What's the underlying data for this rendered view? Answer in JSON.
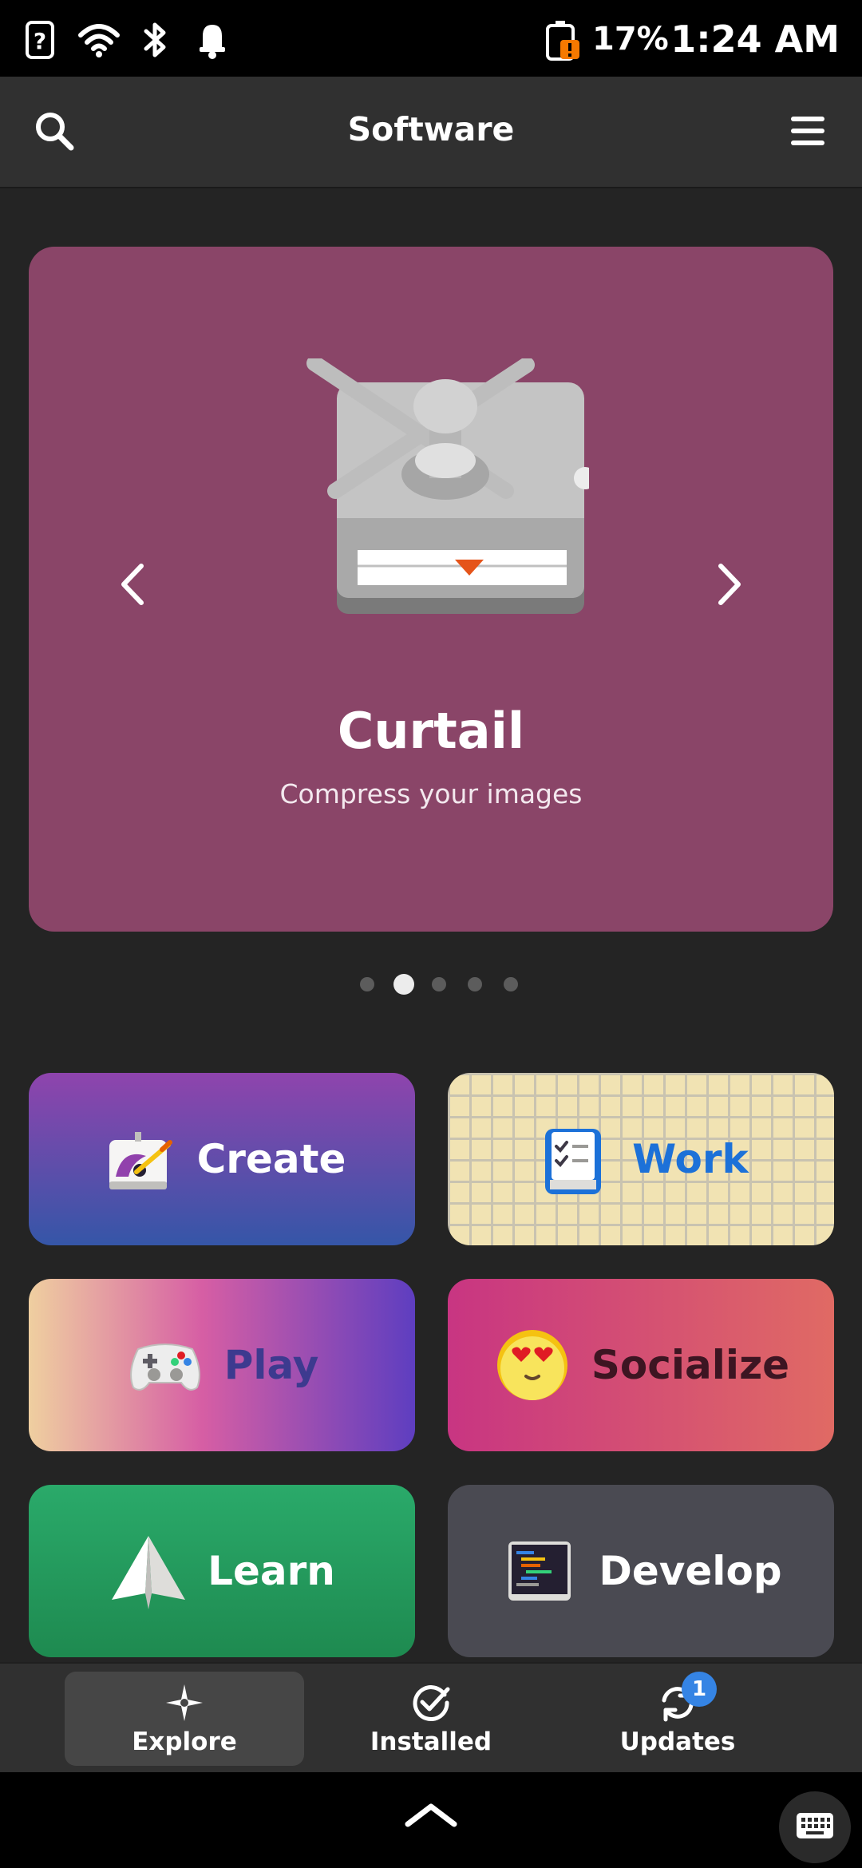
{
  "status_bar": {
    "battery_percent": "17%",
    "time": "1:24 AM"
  },
  "header": {
    "title": "Software",
    "search_icon": "search-icon",
    "menu_icon": "hamburger-menu-icon"
  },
  "featured": {
    "app_name": "Curtail",
    "app_summary": "Compress your images",
    "background_color": "#8a4568",
    "active_page": 2,
    "page_count": 5
  },
  "categories": [
    {
      "label": "Create",
      "icon": "paint-easel-icon",
      "text_color": "#ffffff"
    },
    {
      "label": "Work",
      "icon": "checklist-clipboard-icon",
      "text_color": "#1c71d8"
    },
    {
      "label": "Play",
      "icon": "gamepad-icon",
      "text_color": "#3d3a8f"
    },
    {
      "label": "Socialize",
      "icon": "heart-eyes-emoji-icon",
      "text_color": "#3d1522"
    },
    {
      "label": "Learn",
      "icon": "paper-plane-icon",
      "text_color": "#ffffff"
    },
    {
      "label": "Develop",
      "icon": "terminal-code-icon",
      "text_color": "#ffffff"
    }
  ],
  "bottom_nav": [
    {
      "label": "Explore",
      "icon": "explore-star-icon",
      "active": true
    },
    {
      "label": "Installed",
      "icon": "installed-check-icon",
      "active": false
    },
    {
      "label": "Updates",
      "icon": "updates-refresh-icon",
      "active": false,
      "badge": "1"
    }
  ],
  "colors": {
    "accent": "#3584e4",
    "background": "#242424",
    "headerbar": "#303030"
  }
}
